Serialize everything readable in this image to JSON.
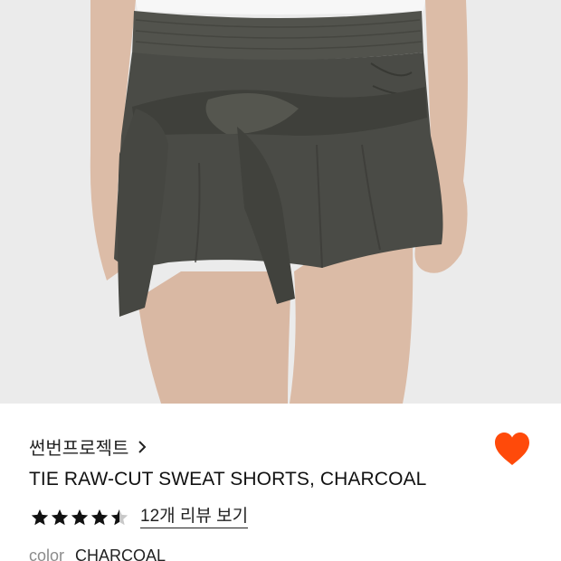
{
  "product": {
    "brand": "썬번프로젝트",
    "title": "TIE RAW-CUT SWEAT SHORTS, CHARCOAL",
    "rating": 4.5,
    "review_link": "12개 리뷰 보기",
    "color_label": "color",
    "color_value": "CHARCOAL",
    "liked": true
  },
  "icons": {
    "brand_chevron": "chevron-right-icon",
    "wishlist": "heart-icon",
    "rating": "star-icon"
  },
  "colors": {
    "heart": "#ff4a0a",
    "star": "#111111",
    "star_empty": "#c8c8c8",
    "garment": "#4a4b46",
    "image_bg": "#ebebeb",
    "muted_text": "#8c8c8c"
  }
}
